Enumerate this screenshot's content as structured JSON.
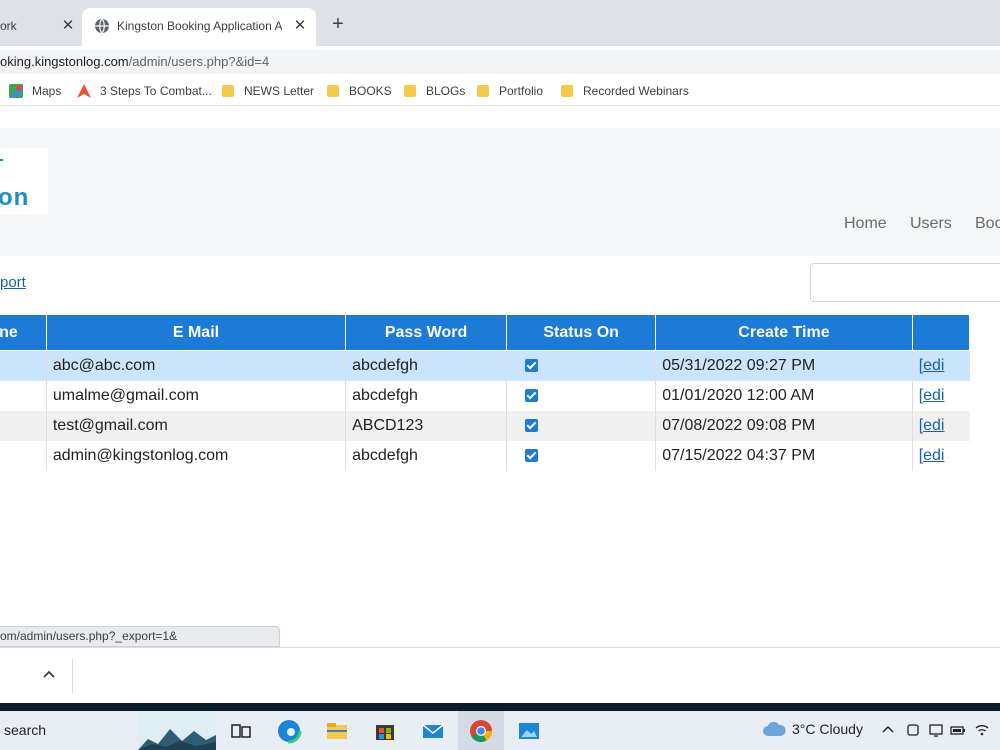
{
  "browser": {
    "tabs": [
      {
        "title": "ork",
        "active": false
      },
      {
        "title": "Kingston Booking Application Ad",
        "active": true
      }
    ],
    "address": {
      "host": "oking.kingstonlog.com",
      "path": "/admin/users.php?&id=4"
    },
    "bookmarks": [
      {
        "label": "Maps",
        "icon": "maps-icon"
      },
      {
        "label": "3 Steps To Combat...",
        "icon": "combat-icon"
      },
      {
        "label": "NEWS Letter",
        "icon": "folder-icon"
      },
      {
        "label": "BOOKS",
        "icon": "folder-icon"
      },
      {
        "label": "BLOGs",
        "icon": "folder-icon"
      },
      {
        "label": "Portfolio",
        "icon": "folder-icon"
      },
      {
        "label": "Recorded Webinars",
        "icon": "folder-icon"
      }
    ],
    "status_url": "om/admin/users.php?_export=1&"
  },
  "app": {
    "logo_text": "on",
    "nav": [
      "Home",
      "Users",
      "Boo"
    ],
    "export_label": "port",
    "search_placeholder": "",
    "table": {
      "headers": [
        "ne",
        "E Mail",
        "Pass Word",
        "Status On",
        "Create Time",
        ""
      ],
      "rows": [
        {
          "email": "abc@abc.com",
          "password": "abcdefgh",
          "status": true,
          "created": "05/31/2022 09:27 PM",
          "action": "[edi"
        },
        {
          "email": "umalme@gmail.com",
          "password": "abcdefgh",
          "status": true,
          "created": "01/01/2020 12:00 AM",
          "action": "[edi"
        },
        {
          "email": "test@gmail.com",
          "password": "ABCD123",
          "status": true,
          "created": "07/08/2022 09:08 PM",
          "action": "[edi"
        },
        {
          "email": "admin@kingstonlog.com",
          "password": "abcdefgh",
          "status": true,
          "created": "07/15/2022 04:37 PM",
          "action": "[edi"
        }
      ]
    }
  },
  "taskbar": {
    "search_label": "search",
    "weather": "3°C  Cloudy"
  },
  "colors": {
    "accent": "#1b7bd6",
    "selected_row": "#c9e4fb",
    "link": "#1a5fb4"
  }
}
